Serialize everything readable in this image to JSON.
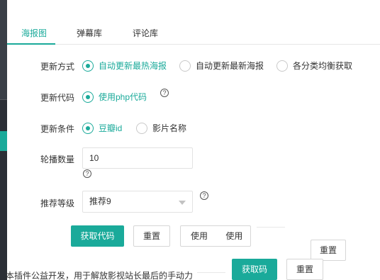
{
  "tabs": [
    {
      "label": "海报图"
    },
    {
      "label": "弹幕库"
    },
    {
      "label": "评论库"
    }
  ],
  "form": {
    "update_mode": {
      "label": "更新方式",
      "options": [
        {
          "label": "自动更新最热海报",
          "checked": true
        },
        {
          "label": "自动更新最新海报",
          "checked": false
        },
        {
          "label": "各分类均衡获取",
          "checked": false
        }
      ]
    },
    "update_code": {
      "label": "更新代码",
      "options": [
        {
          "label": "使用php代码",
          "checked": true
        }
      ],
      "help": "?"
    },
    "update_condition": {
      "label": "更新条件",
      "options": [
        {
          "label": "豆瓣id",
          "checked": true
        },
        {
          "label": "影片名称",
          "checked": false
        }
      ]
    },
    "carousel_count": {
      "label": "轮播数量",
      "value": "10",
      "help": "?"
    },
    "recommend_level": {
      "label": "推荐等级",
      "selected": "推荐9",
      "help": "?"
    }
  },
  "buttons": {
    "get_code": "获取代码",
    "reset": "重置",
    "usage1": "使用",
    "usage2": "使用",
    "reset_ghost": "重置",
    "get_code_ghost": "获取码",
    "reset_ghost2": "重置"
  },
  "footer": {
    "text": "本插件公益开发，用于解放影视站长最后的手动力"
  },
  "colors": {
    "accent": "#1aaa9a",
    "sidebar": "#2b2f36"
  }
}
